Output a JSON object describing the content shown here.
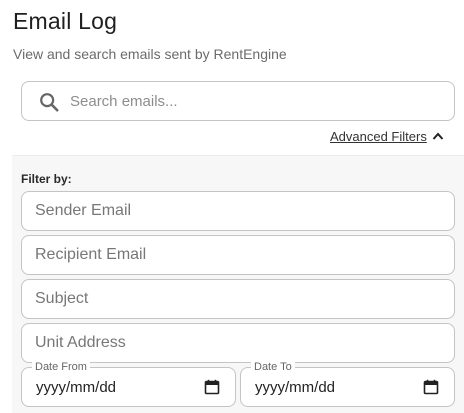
{
  "header": {
    "title": "Email Log",
    "subtitle": "View and search emails sent by RentEngine"
  },
  "search": {
    "placeholder": "Search emails...",
    "icon": "search-icon"
  },
  "advanced_filters": {
    "label": "Advanced Filters",
    "icon": "chevron-up-icon",
    "expanded": true
  },
  "filters": {
    "heading": "Filter by:",
    "sender_placeholder": "Sender Email",
    "recipient_placeholder": "Recipient Email",
    "subject_placeholder": "Subject",
    "unit_address_placeholder": "Unit Address",
    "date_from_label": "Date From",
    "date_from_value": "yyyy/mm/dd",
    "date_to_label": "Date To",
    "date_to_value": "yyyy/mm/dd"
  },
  "colors": {
    "border": "#c4c4c4",
    "panel_background": "#f7f7f7"
  }
}
